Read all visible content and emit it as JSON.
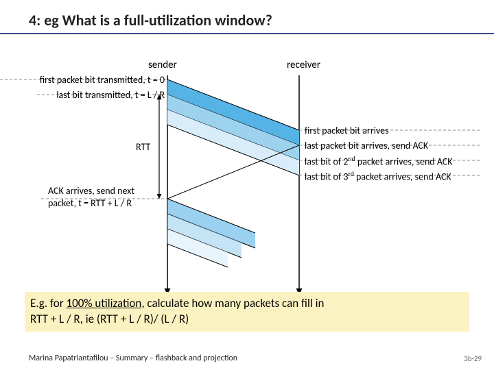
{
  "title": "4: eg What is a full-utilization window?",
  "diagram": {
    "sender_label": "sender",
    "receiver_label": "receiver",
    "left_events": [
      "first packet bit transmitted, t = 0",
      "last bit transmitted, t = L / R"
    ],
    "rtt_label": "RTT",
    "right_events": [
      "first packet bit arrives",
      "last packet bit arrives, send ACK",
      [
        "last bit of 2",
        "nd",
        " packet arrives, send ACK"
      ],
      [
        "last bit of 3",
        "rd",
        " packet arrives, send ACK"
      ]
    ],
    "ack_event": [
      "ACK arrives, send next",
      "packet, t = RTT + L / R"
    ]
  },
  "example": {
    "line1_pre": "E.g. for ",
    "line1_u": "100% utilization",
    "line1_post": ", calculate how many packets can fill in",
    "line2": "RTT + L / R,  ie (RTT + L / R)/ (L / R)"
  },
  "footer": "Marina Papatriantafilou – Summary – flashback and projection",
  "page": "3b-29"
}
